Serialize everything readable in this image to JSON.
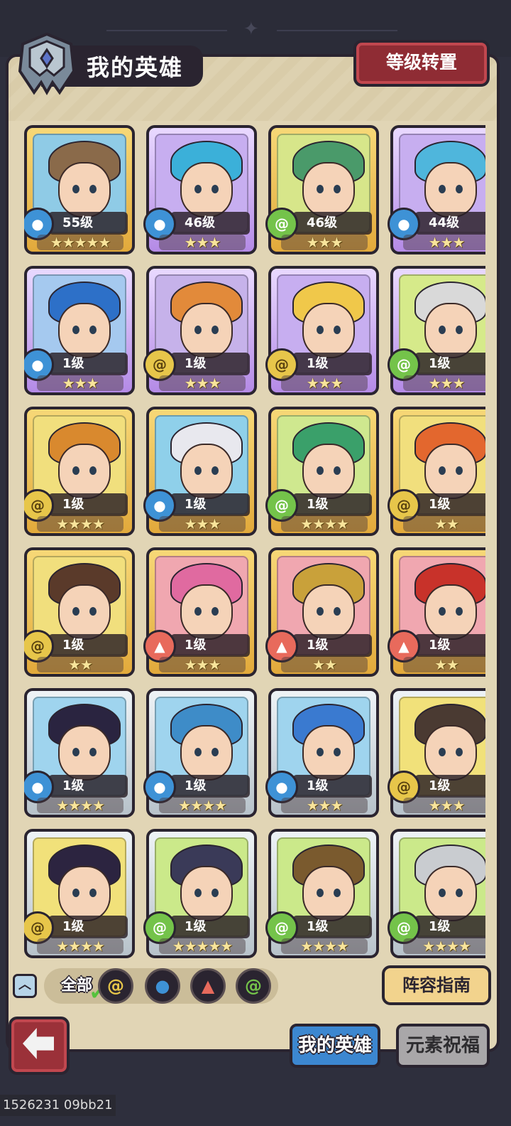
{
  "header": {
    "title": "我的英雄",
    "rank_transfer_label": "等级转置"
  },
  "heroes": [
    {
      "level": "55级",
      "element": "water",
      "rarity": "gold",
      "stars": 5,
      "bg": "#8fcbe6",
      "hair": "#8a6a4a"
    },
    {
      "level": "46级",
      "element": "water",
      "rarity": "purple",
      "stars": 3,
      "bg": "#c7aef0",
      "hair": "#3bb0d9"
    },
    {
      "level": "46级",
      "element": "wind",
      "rarity": "gold",
      "stars": 3,
      "bg": "#d7e68a",
      "hair": "#4a9a6a"
    },
    {
      "level": "44级",
      "element": "water",
      "rarity": "purple",
      "stars": 3,
      "bg": "#c7aef0",
      "hair": "#4fb6dc"
    },
    {
      "level": "1级",
      "element": "water",
      "rarity": "purple",
      "stars": 3,
      "bg": "#a5c9ef",
      "hair": "#2d70c8"
    },
    {
      "level": "1级",
      "element": "earth",
      "rarity": "purple",
      "stars": 3,
      "bg": "#c6b2ea",
      "hair": "#e28a3a"
    },
    {
      "level": "1级",
      "element": "earth",
      "rarity": "purple",
      "stars": 3,
      "bg": "#c7aef0",
      "hair": "#f0c84a"
    },
    {
      "level": "1级",
      "element": "wind",
      "rarity": "purple",
      "stars": 3,
      "bg": "#d6ea8a",
      "hair": "#d9d9d9"
    },
    {
      "level": "1级",
      "element": "earth",
      "rarity": "gold",
      "stars": 4,
      "bg": "#f1df7d",
      "hair": "#d9892e"
    },
    {
      "level": "1级",
      "element": "water",
      "rarity": "gold",
      "stars": 3,
      "bg": "#8fd0ea",
      "hair": "#e8e8ee"
    },
    {
      "level": "1级",
      "element": "wind",
      "rarity": "gold",
      "stars": 4,
      "bg": "#cfe88f",
      "hair": "#3aa06a"
    },
    {
      "level": "1级",
      "element": "earth",
      "rarity": "gold",
      "stars": 2,
      "bg": "#f1df7d",
      "hair": "#e3672e"
    },
    {
      "level": "1级",
      "element": "earth",
      "rarity": "gold",
      "stars": 2,
      "bg": "#f1df7d",
      "hair": "#5a3a2a"
    },
    {
      "level": "1级",
      "element": "fire",
      "rarity": "gold",
      "stars": 3,
      "bg": "#f0a7b0",
      "hair": "#e06aa0"
    },
    {
      "level": "1级",
      "element": "fire",
      "rarity": "gold",
      "stars": 2,
      "bg": "#f0a7b0",
      "hair": "#c9a13a"
    },
    {
      "level": "1级",
      "element": "fire",
      "rarity": "gold",
      "stars": 2,
      "bg": "#f0a7b0",
      "hair": "#c8322a"
    },
    {
      "level": "1级",
      "element": "water",
      "rarity": "silver",
      "stars": 4,
      "bg": "#9fd4ee",
      "hair": "#2a2440"
    },
    {
      "level": "1级",
      "element": "water",
      "rarity": "silver",
      "stars": 4,
      "bg": "#9fd4ee",
      "hair": "#3e8cc8"
    },
    {
      "level": "1级",
      "element": "water",
      "rarity": "silver",
      "stars": 3,
      "bg": "#9fd4ee",
      "hair": "#3a7ad0"
    },
    {
      "level": "1级",
      "element": "earth",
      "rarity": "silver",
      "stars": 3,
      "bg": "#f1e17a",
      "hair": "#4a3a32"
    },
    {
      "level": "1级",
      "element": "earth",
      "rarity": "silver",
      "stars": 4,
      "bg": "#f1e17a",
      "hair": "#2c2440"
    },
    {
      "level": "1级",
      "element": "wind",
      "rarity": "silver",
      "stars": 5,
      "bg": "#cbe98a",
      "hair": "#3a3a58"
    },
    {
      "level": "1级",
      "element": "wind",
      "rarity": "silver",
      "stars": 4,
      "bg": "#cbe98a",
      "hair": "#7a5a2e"
    },
    {
      "level": "1级",
      "element": "wind",
      "rarity": "silver",
      "stars": 4,
      "bg": "#cbe98a",
      "hair": "#c9ccd0"
    }
  ],
  "element_colors": {
    "water": "#3e92d6",
    "earth": "#e7c64a",
    "wind": "#74c34a",
    "fire": "#e86a5c"
  },
  "element_icons": {
    "water": "water-drop-icon",
    "earth": "earth-swirl-icon",
    "wind": "wind-swirl-icon",
    "fire": "fire-flame-icon"
  },
  "filter": {
    "all_label": "全部",
    "elements": [
      "earth",
      "water",
      "fire",
      "wind"
    ]
  },
  "lineup_guide_label": "阵容指南",
  "tabs": {
    "my_heroes": "我的英雄",
    "element_blessing": "元素祝福"
  },
  "watermark": "1526231 09bb21"
}
